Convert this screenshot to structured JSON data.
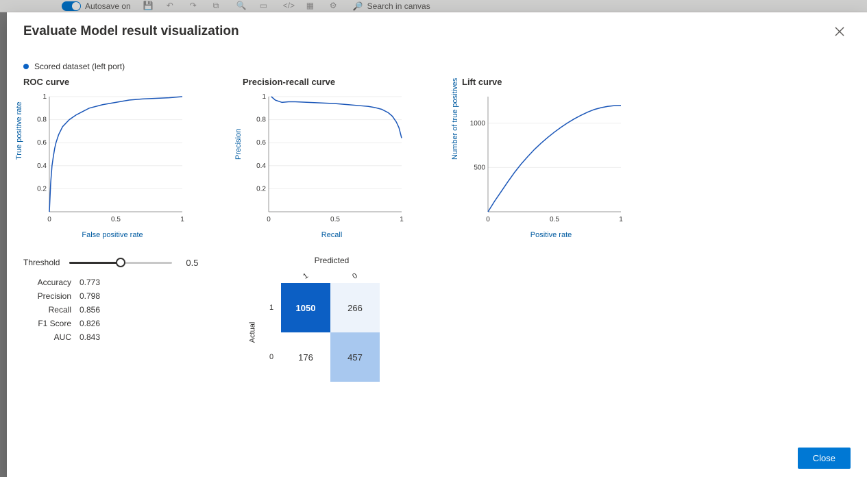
{
  "toolbar": {
    "autosave_label": "Autosave on",
    "search_placeholder": "Search in canvas"
  },
  "modal": {
    "title": "Evaluate Model result visualization",
    "close_btn": "Close"
  },
  "legend": {
    "label": "Scored dataset (left port)"
  },
  "roc": {
    "title": "ROC curve",
    "xlabel": "False positive rate",
    "ylabel": "True positive rate"
  },
  "pr": {
    "title": "Precision-recall curve",
    "xlabel": "Recall",
    "ylabel": "Precision"
  },
  "lift": {
    "title": "Lift curve",
    "xlabel": "Positive rate",
    "ylabel": "Number of true positives"
  },
  "threshold": {
    "label": "Threshold",
    "value": "0.5"
  },
  "metrics": {
    "accuracy_label": "Accuracy",
    "accuracy": "0.773",
    "precision_label": "Precision",
    "precision": "0.798",
    "recall_label": "Recall",
    "recall": "0.856",
    "f1_label": "F1 Score",
    "f1": "0.826",
    "auc_label": "AUC",
    "auc": "0.843"
  },
  "confusion": {
    "pred_label": "Predicted",
    "actual_label": "Actual",
    "row1_label": "1",
    "row0_label": "0",
    "col1_label": "1",
    "col0_label": "0",
    "tp": "1050",
    "fn": "266",
    "fp": "176",
    "tn": "457"
  },
  "chart_data": [
    {
      "type": "line",
      "name": "ROC curve",
      "xlabel": "False positive rate",
      "ylabel": "True positive rate",
      "xlim": [
        0,
        1
      ],
      "ylim": [
        0,
        1
      ],
      "x": [
        0,
        0.01,
        0.02,
        0.03,
        0.04,
        0.05,
        0.07,
        0.1,
        0.15,
        0.2,
        0.25,
        0.3,
        0.4,
        0.5,
        0.6,
        0.7,
        0.8,
        0.9,
        1.0
      ],
      "y": [
        0,
        0.25,
        0.4,
        0.48,
        0.55,
        0.6,
        0.67,
        0.74,
        0.8,
        0.84,
        0.87,
        0.9,
        0.93,
        0.95,
        0.97,
        0.98,
        0.985,
        0.99,
        1.0
      ]
    },
    {
      "type": "line",
      "name": "Precision-recall curve",
      "xlabel": "Recall",
      "ylabel": "Precision",
      "xlim": [
        0,
        1
      ],
      "ylim": [
        0,
        1
      ],
      "x": [
        0.02,
        0.05,
        0.1,
        0.15,
        0.2,
        0.3,
        0.4,
        0.5,
        0.6,
        0.7,
        0.75,
        0.8,
        0.85,
        0.9,
        0.93,
        0.96,
        0.98,
        1.0
      ],
      "y": [
        1.0,
        0.97,
        0.95,
        0.955,
        0.955,
        0.95,
        0.945,
        0.94,
        0.93,
        0.92,
        0.915,
        0.905,
        0.89,
        0.86,
        0.83,
        0.78,
        0.73,
        0.64
      ]
    },
    {
      "type": "line",
      "name": "Lift curve",
      "xlabel": "Positive rate",
      "ylabel": "Number of true positives",
      "xlim": [
        0,
        1
      ],
      "ylim": [
        0,
        1300
      ],
      "x": [
        0,
        0.05,
        0.1,
        0.15,
        0.2,
        0.25,
        0.3,
        0.35,
        0.4,
        0.45,
        0.5,
        0.55,
        0.6,
        0.65,
        0.7,
        0.75,
        0.8,
        0.85,
        0.9,
        0.95,
        1.0
      ],
      "y": [
        0,
        120,
        230,
        340,
        445,
        540,
        625,
        705,
        775,
        840,
        900,
        955,
        1005,
        1050,
        1090,
        1125,
        1155,
        1175,
        1190,
        1198,
        1200
      ]
    }
  ]
}
